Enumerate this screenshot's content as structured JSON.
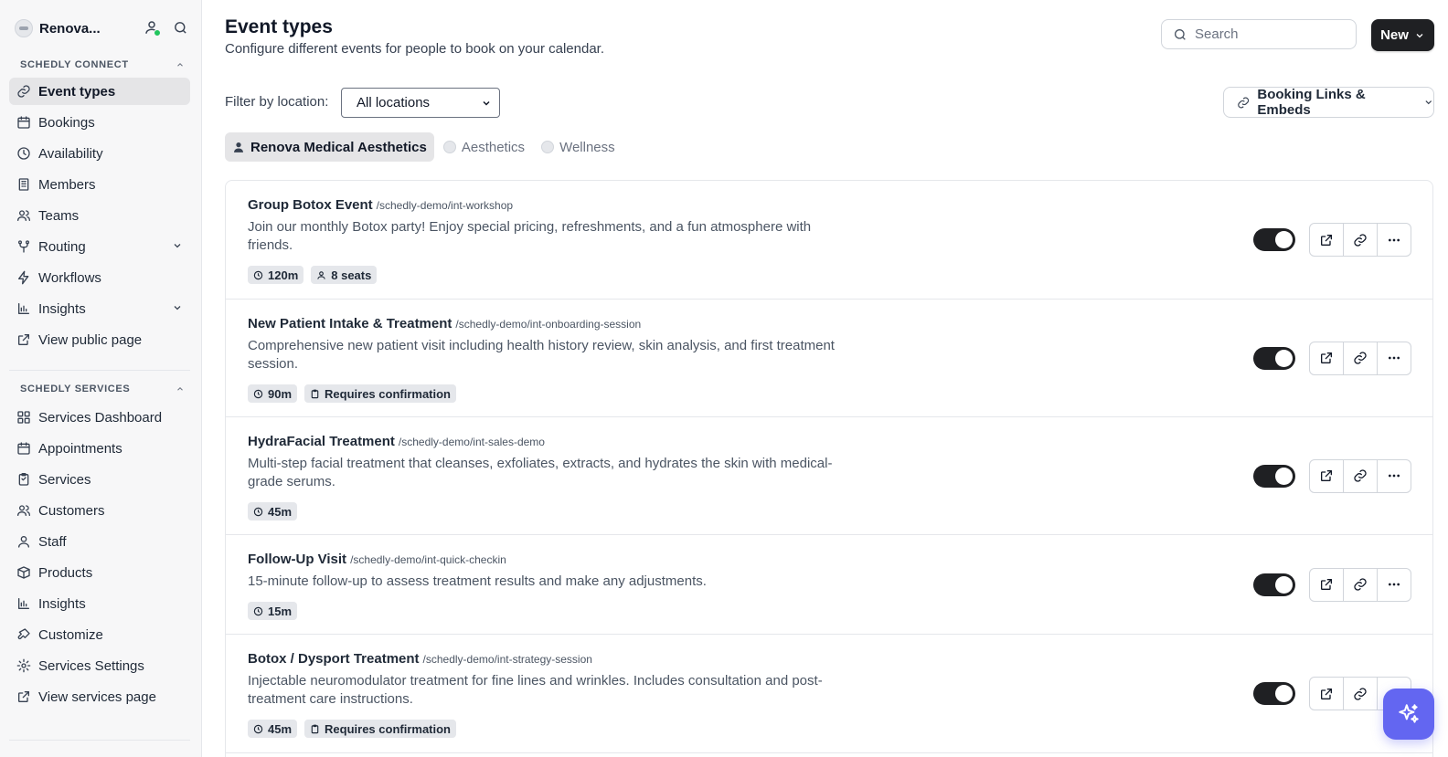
{
  "org": {
    "name": "Renova..."
  },
  "sidebar": {
    "connect_label": "SCHEDLY CONNECT",
    "services_label": "SCHEDLY SERVICES",
    "connect_items": [
      {
        "label": "Event types",
        "icon": "link-icon"
      },
      {
        "label": "Bookings",
        "icon": "calendar-icon"
      },
      {
        "label": "Availability",
        "icon": "clock-icon"
      },
      {
        "label": "Members",
        "icon": "building-icon"
      },
      {
        "label": "Teams",
        "icon": "users-icon"
      },
      {
        "label": "Routing",
        "icon": "split-icon"
      },
      {
        "label": "Workflows",
        "icon": "zap-icon"
      },
      {
        "label": "Insights",
        "icon": "bar-chart-icon"
      },
      {
        "label": "View public page",
        "icon": "external-link-icon"
      }
    ],
    "services_items": [
      {
        "label": "Services Dashboard",
        "icon": "dashboard-icon"
      },
      {
        "label": "Appointments",
        "icon": "calendar-icon"
      },
      {
        "label": "Services",
        "icon": "clipboard-icon"
      },
      {
        "label": "Customers",
        "icon": "users-icon"
      },
      {
        "label": "Staff",
        "icon": "user-icon"
      },
      {
        "label": "Products",
        "icon": "box-icon"
      },
      {
        "label": "Insights",
        "icon": "bar-chart-icon"
      },
      {
        "label": "Customize",
        "icon": "paint-icon"
      },
      {
        "label": "Services Settings",
        "icon": "gear-icon"
      },
      {
        "label": "View services page",
        "icon": "external-link-icon"
      }
    ]
  },
  "header": {
    "title": "Event types",
    "subtitle": "Configure different events for people to book on your calendar.",
    "search_placeholder": "Search",
    "new_label": "New"
  },
  "filter": {
    "label": "Filter by location:",
    "selected": "All locations",
    "links_label": "Booking Links & Embeds"
  },
  "tabs": [
    {
      "label": "Renova Medical Aesthetics",
      "active": true
    },
    {
      "label": "Aesthetics",
      "active": false
    },
    {
      "label": "Wellness",
      "active": false
    }
  ],
  "events": [
    {
      "title": "Group Botox Event",
      "slug": "/schedly-demo/int-workshop",
      "description": "Join our monthly Botox party! Enjoy special pricing, refreshments, and a fun atmosphere with friends.",
      "duration": "120m",
      "extra": "8 seats",
      "enabled": true
    },
    {
      "title": "New Patient Intake & Treatment",
      "slug": "/schedly-demo/int-onboarding-session",
      "description": "Comprehensive new patient visit including health history review, skin analysis, and first treatment session.",
      "duration": "90m",
      "extra": "Requires confirmation",
      "enabled": true
    },
    {
      "title": "HydraFacial Treatment",
      "slug": "/schedly-demo/int-sales-demo",
      "description": "Multi-step facial treatment that cleanses, exfoliates, extracts, and hydrates the skin with medical-grade serums.",
      "duration": "45m",
      "extra": "",
      "enabled": true
    },
    {
      "title": "Follow-Up Visit",
      "slug": "/schedly-demo/int-quick-checkin",
      "description": "15-minute follow-up to assess treatment results and make any adjustments.",
      "duration": "15m",
      "extra": "",
      "enabled": true
    },
    {
      "title": "Botox / Dysport Treatment",
      "slug": "/schedly-demo/int-strategy-session",
      "description": "Injectable neuromodulator treatment for fine lines and wrinkles. Includes consultation and post-treatment care instructions.",
      "duration": "45m",
      "extra": "Requires confirmation",
      "enabled": true
    }
  ],
  "colors": {
    "accent": "#1f2023",
    "fab": "#6366f1",
    "status_online": "#22c55e"
  }
}
